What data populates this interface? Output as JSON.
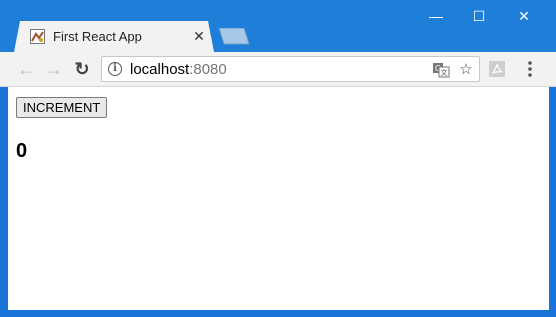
{
  "browser": {
    "tab": {
      "title": "First React App",
      "close_glyph": "✕",
      "favicon": "react-app-favicon"
    },
    "window_controls": {
      "minimize_glyph": "—",
      "maximize_glyph": "☐",
      "close_glyph": "✕"
    },
    "toolbar": {
      "back_glyph": "←",
      "forward_glyph": "→",
      "reload_glyph": "↻",
      "info_glyph": "i",
      "url_host": "localhost",
      "url_port": ":8080",
      "translate_icon": "translate-icon",
      "star_glyph": "☆",
      "extension_icon": "pdf-extension-icon",
      "menu_icon": "kebab-menu-icon"
    },
    "colors": {
      "titlebar": "#1f7fd8",
      "tab": "#f2f2f2",
      "toolbar": "#f2f2f2"
    }
  },
  "app": {
    "increment_label": "INCREMENT",
    "count": "0"
  }
}
